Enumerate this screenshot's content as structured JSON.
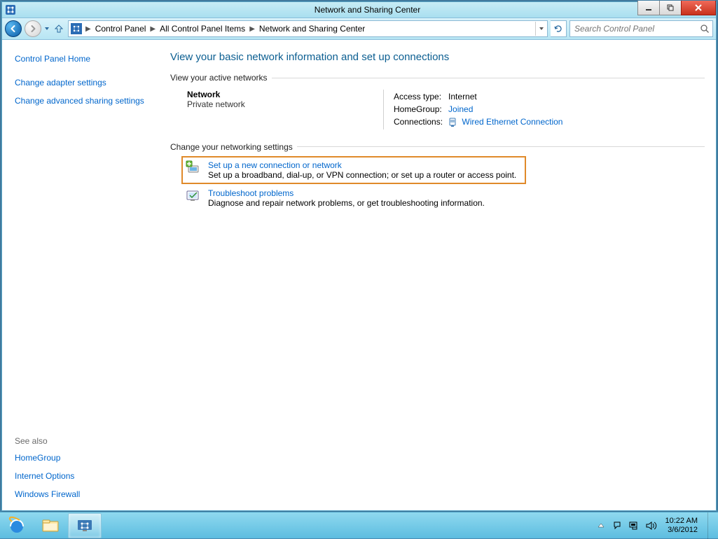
{
  "window": {
    "title": "Network and Sharing Center",
    "breadcrumb": [
      "Control Panel",
      "All Control Panel Items",
      "Network and Sharing Center"
    ],
    "search_placeholder": "Search Control Panel"
  },
  "sidebar": {
    "home": "Control Panel Home",
    "links": [
      "Change adapter settings",
      "Change advanced sharing settings"
    ],
    "see_also_label": "See also",
    "see_also": [
      "HomeGroup",
      "Internet Options",
      "Windows Firewall"
    ]
  },
  "main": {
    "page_title": "View your basic network information and set up connections",
    "active_networks_label": "View your active networks",
    "network": {
      "name": "Network",
      "type": "Private network",
      "access_label": "Access type:",
      "access_value": "Internet",
      "homegroup_label": "HomeGroup:",
      "homegroup_value": "Joined",
      "connections_label": "Connections:",
      "connections_value": "Wired Ethernet Connection"
    },
    "change_settings_label": "Change your networking settings",
    "settings": [
      {
        "title": "Set up a new connection or network",
        "desc": "Set up a broadband, dial-up, or VPN connection; or set up a router or access point."
      },
      {
        "title": "Troubleshoot problems",
        "desc": "Diagnose and repair network problems, or get troubleshooting information."
      }
    ]
  },
  "taskbar": {
    "time": "10:22 AM",
    "date": "3/6/2012"
  }
}
